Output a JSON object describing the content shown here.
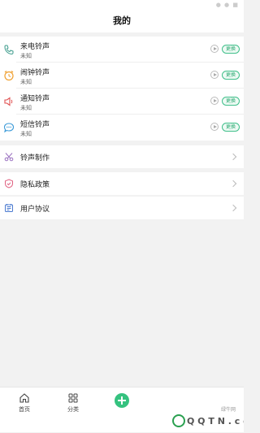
{
  "header": {
    "title": "我的",
    "status": "● ● ■"
  },
  "ringtones": [
    {
      "label": "来电铃声",
      "sub": "未知",
      "action": "更换",
      "icon": "phone-icon",
      "color": "#3a9a8a"
    },
    {
      "label": "闹钟铃声",
      "sub": "未知",
      "action": "更换",
      "icon": "alarm-clock-icon",
      "color": "#f0a030"
    },
    {
      "label": "通知铃声",
      "sub": "未知",
      "action": "更换",
      "icon": "speaker-icon",
      "color": "#e05050"
    },
    {
      "label": "短信铃声",
      "sub": "未知",
      "action": "更换",
      "icon": "message-icon",
      "color": "#3a9ad8"
    }
  ],
  "menu": [
    {
      "label": "铃声制作",
      "icon": "scissors-icon",
      "color": "#9a70c0"
    },
    {
      "label": "隐私政策",
      "icon": "shield-icon",
      "color": "#e06080"
    },
    {
      "label": "用户协议",
      "icon": "document-icon",
      "color": "#4a7ad0"
    }
  ],
  "tabs": [
    {
      "label": "首页",
      "icon": "home-icon"
    },
    {
      "label": "分类",
      "icon": "grid-icon"
    },
    {
      "label": "",
      "icon": "add-icon"
    }
  ],
  "watermark": {
    "text": "Q Q T N . c o m",
    "small": "绿牛网",
    "color": "#2aa050"
  }
}
